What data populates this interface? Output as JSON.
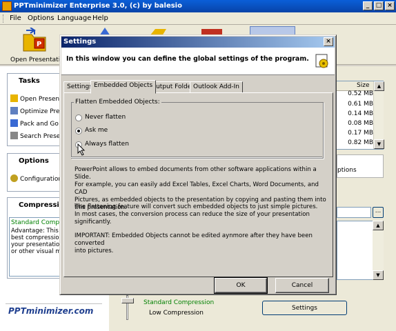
{
  "window": {
    "title": "PPTminimizer Enterprise 3.0, (c) by balesio",
    "min": "_",
    "max": "□",
    "close": "×"
  },
  "menu": [
    "File",
    "Options",
    "Language",
    "Help"
  ],
  "toolbar": {
    "open_label": "Open Presentation"
  },
  "tasks": {
    "title": "Tasks",
    "items": [
      "Open Presentations",
      "Optimize Presentations",
      "Pack and Go",
      "Search Presentations"
    ]
  },
  "options": {
    "title": "Options",
    "items": [
      "Configuration"
    ]
  },
  "compression": {
    "title": "Compression",
    "selected": "Standard Compression",
    "text": [
      "Advantage: This is the",
      "best compression",
      "your presentations",
      "or other visual media"
    ]
  },
  "logo": "PPTminimizer.com",
  "file_list": {
    "column": "Size",
    "sizes": [
      "0.52 MB",
      "0.61 MB",
      "0.14 MB",
      "0.08 MB",
      "0.17 MB",
      "0.82 MB"
    ],
    "options_text": "ptions",
    "browse": "..."
  },
  "bottom": {
    "standard": "Standard Compression",
    "low": "Low Compression",
    "settings_button": "Settings"
  },
  "dialog": {
    "title": "Settings",
    "close": "×",
    "header": "In this window you can define the global settings of the program.",
    "tabs": [
      "Settings",
      "Embedded Objects",
      "Output Folder",
      "Outlook Add-In"
    ],
    "active_tab": 1,
    "group_label": "Flatten Embedded Objects:",
    "radios": [
      {
        "label": "Never flatten",
        "checked": false
      },
      {
        "label": "Ask me",
        "checked": true
      },
      {
        "label": "Always flatten",
        "checked": false
      }
    ],
    "p1": [
      "PowerPoint allows to embed documents from other software applications within a Slide.",
      "For example, you can easily add Excel Tables, Excel Charts, Word Documents, and CAD",
      "Pictures, as embedded objects to the presentation by copying and pasting them into",
      "this presentation."
    ],
    "p2": [
      "The flattening feature will convert such embedded objects to just simple pictures.",
      "In most cases, the conversion process can reduce the size of your presentation significantly."
    ],
    "p3": [
      "IMPORTANT: Embedded Objects cannot be edited aynmore after they have been converted",
      "into pictures."
    ],
    "ok": "OK",
    "cancel": "Cancel"
  },
  "colors": {
    "titlebar": "#0843a8",
    "dialog_title": "#0a246a",
    "compression_green": "#008000"
  }
}
